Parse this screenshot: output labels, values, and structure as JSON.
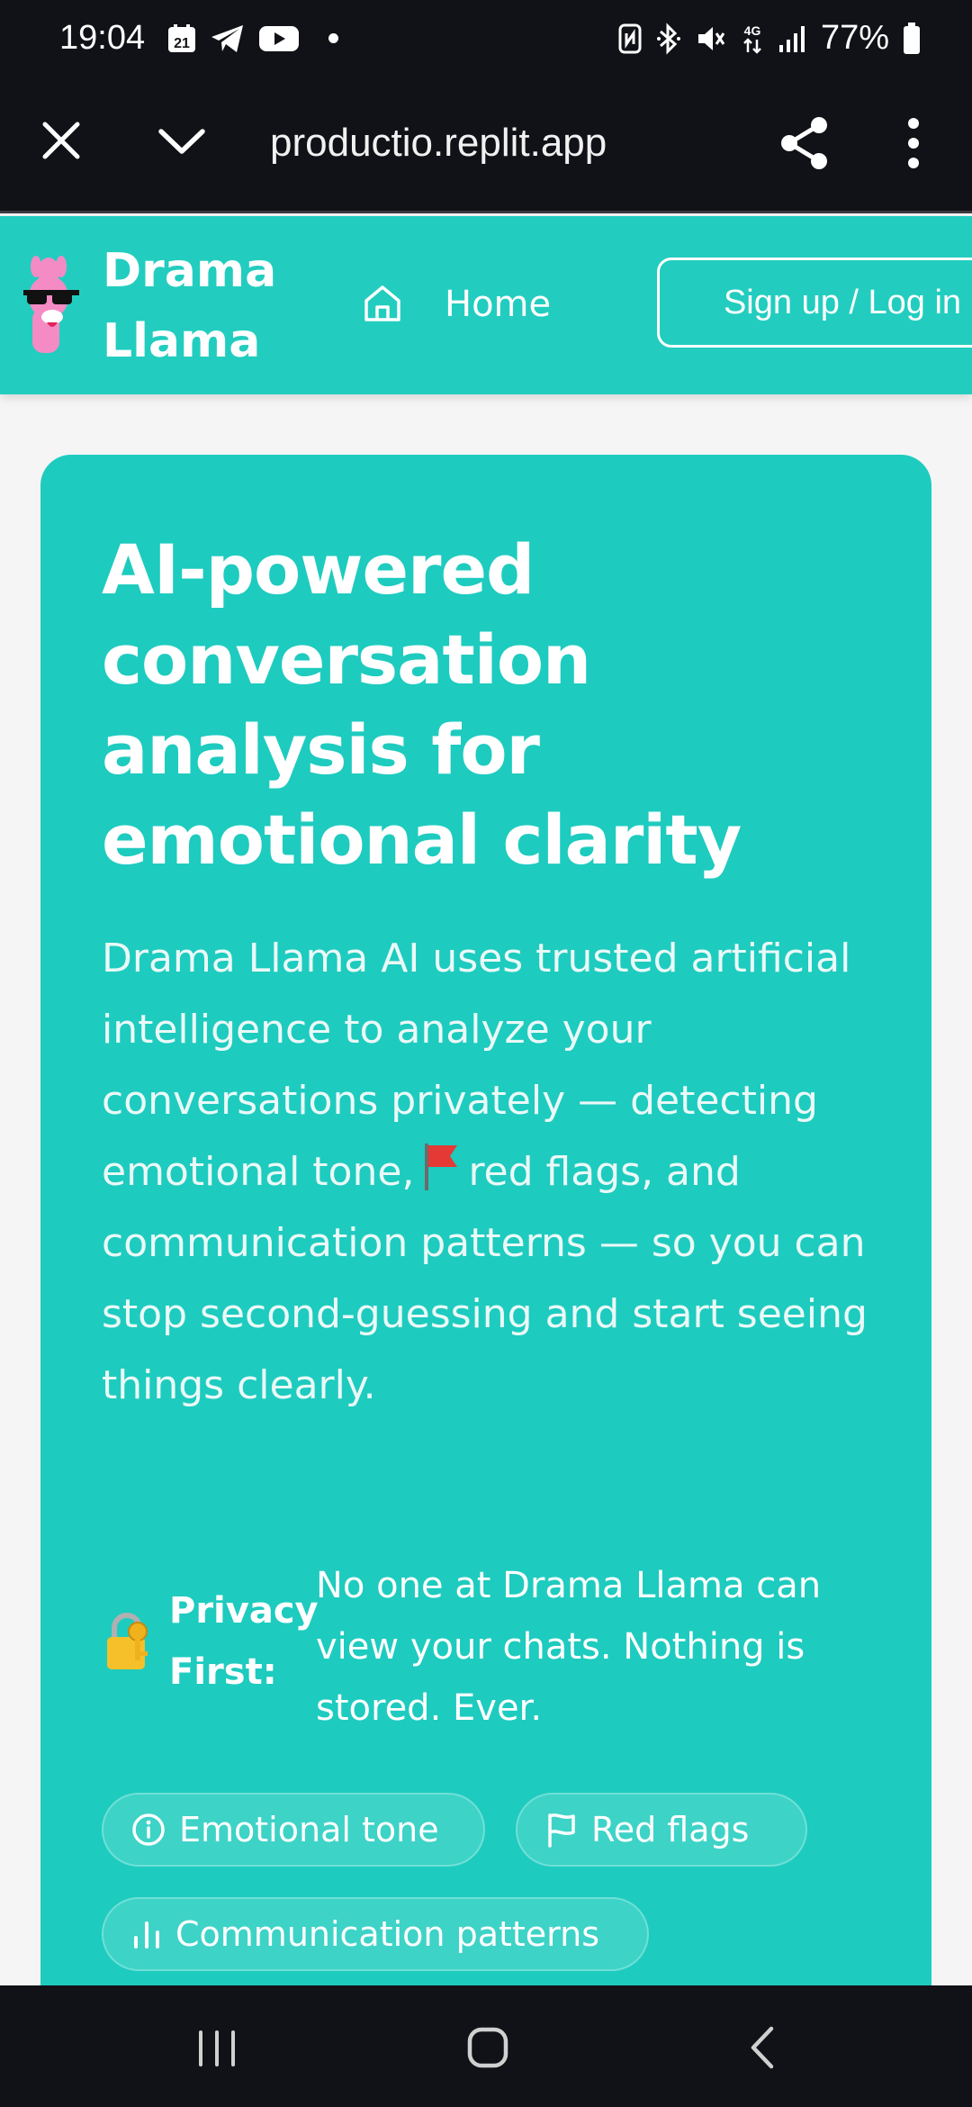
{
  "status_bar": {
    "time": "19:04",
    "calendar_day": "21",
    "notifications": [
      "calendar-icon",
      "telegram-icon",
      "youtube-icon"
    ],
    "system_icons": [
      "nfc-icon",
      "bluetooth-icon",
      "mute-icon",
      "network-4g-icon",
      "signal-icon"
    ],
    "network_type": "4G",
    "battery": "77%"
  },
  "browser": {
    "url": "productio.replit.app",
    "close_icon": "close-icon",
    "tabs_icon": "chevron-down-icon",
    "share_icon": "share-icon",
    "menu_icon": "more-vert-icon"
  },
  "site_header": {
    "brand_line1": "Drama",
    "brand_line2": "Llama",
    "home_label": "Home",
    "signup_label": "Sign up / Log in"
  },
  "hero": {
    "title": "AI-powered conversation analysis for emotional clarity",
    "desc_part1": "Drama Llama AI uses trusted artificial intelligence to analyze your conversations privately — detecting emotional tone,",
    "desc_part2": "red flags, and communication patterns — so you can stop second-guessing and start seeing things clearly.",
    "privacy_label": "Privacy First:",
    "privacy_text": "No one at Drama Llama can view your chats. Nothing is stored. Ever.",
    "chips": [
      {
        "label": "Emotional tone",
        "icon": "info-circle-icon"
      },
      {
        "label": "Red flags",
        "icon": "flag-icon"
      },
      {
        "label": "Communication patterns",
        "icon": "bar-chart-icon"
      }
    ]
  },
  "colors": {
    "teal": "#22cdbf",
    "card_teal": "#1ecbbf",
    "chip_bg": "#3ed3c7",
    "dark_bar": "#111217"
  }
}
